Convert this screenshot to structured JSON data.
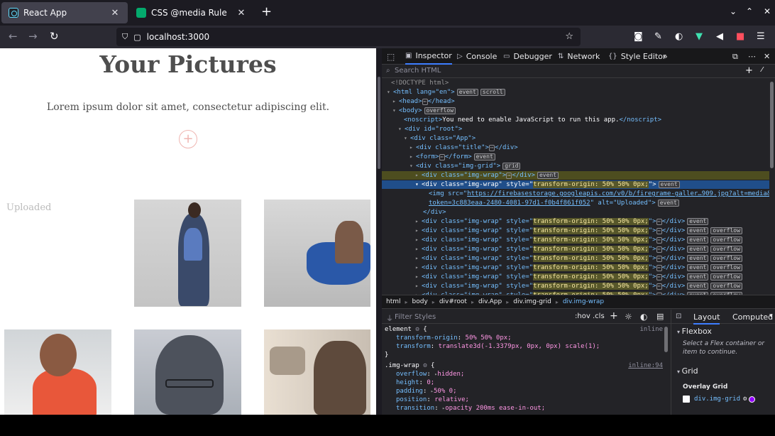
{
  "browser": {
    "tabs": [
      {
        "title": "React App",
        "active": true
      },
      {
        "title": "CSS @media Rule",
        "active": false
      }
    ],
    "url": "localhost:3000"
  },
  "page": {
    "title": "Your Pictures",
    "description": "Lorem ipsum dolor sit amet, consectetur adipiscing elit.",
    "add_label": "+",
    "broken_image_alt": "Uploaded",
    "accent_color": "#efb6b2"
  },
  "devtools": {
    "tabs": [
      "Inspector",
      "Console",
      "Debugger",
      "Network",
      "Style Editor"
    ],
    "search_placeholder": "Search HTML",
    "tree": [
      "<!DOCTYPE html>",
      "<html lang=\"en\">",
      "<head>",
      "</head>",
      "<body>",
      "<noscript>",
      "You need to enable JavaScript to run this app.",
      "</noscript>",
      "<div id=\"root\">",
      "<div class=\"App\">",
      "<div class=\"title\">",
      "</div>",
      "<form>",
      "</form>",
      "<div class=\"img-grid\">",
      "<div class=\"img-wrap\">",
      "<div class=\"img-wrap\" style=\"",
      "transform-origin: 50% 50% 0px;",
      "\">",
      "<img src=\"",
      "https://firebasestorage.googleapis.com/v0/b/firegrame-galler…909.jpg?alt=media&",
      "token=3c883eaa-2480-4081-97d1-f0b4f861f052",
      "\" alt=\"Uploaded\">",
      "</div>"
    ],
    "badges": {
      "event": "event",
      "scroll": "scroll",
      "overflow": "overflow",
      "grid": "grid"
    },
    "breadcrumbs": [
      "html",
      "body",
      "div#root",
      "div.App",
      "div.img-grid",
      "div.img-wrap"
    ],
    "filter_placeholder": "Filter Styles",
    "filter_tools": [
      ":hov",
      ".cls"
    ],
    "rules": {
      "element_selector": "element",
      "element_source": "inline",
      "element_props": [
        {
          "name": "transform-origin",
          "value": "50% 50% 0px;"
        },
        {
          "name": "transform",
          "value": "translate3d(-1.3379px, 0px, 0px) scale(1);"
        }
      ],
      "img_wrap_selector": ".img-wrap",
      "img_wrap_source": "inline:94",
      "img_wrap_props": [
        {
          "name": "overflow",
          "value": "hidden;"
        },
        {
          "name": "height",
          "value": "0;"
        },
        {
          "name": "padding",
          "value": "50% 0;"
        },
        {
          "name": "position",
          "value": "relative;"
        },
        {
          "name": "transition",
          "value": "opacity 200ms  ease-in-out;"
        }
      ]
    },
    "layout": {
      "tabs": [
        "Layout",
        "Computed"
      ],
      "flexbox_title": "Flexbox",
      "flexbox_hint": "Select a Flex container or item to continue.",
      "grid_title": "Grid",
      "overlay_title": "Overlay Grid",
      "overlay_item": "div.img-grid",
      "overlay_color": "#9400ff"
    }
  }
}
